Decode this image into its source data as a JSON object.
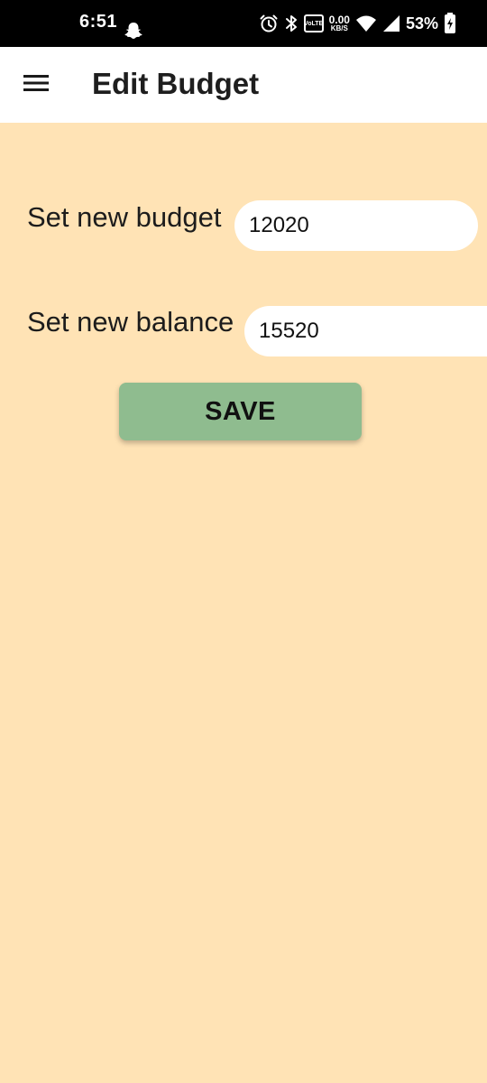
{
  "status_bar": {
    "time": "6:51",
    "icons": [
      "snapchat-icon",
      "alarm-icon",
      "bluetooth-icon",
      "volte-icon",
      "wifi-icon",
      "signal-icon",
      "battery-charging-icon"
    ],
    "volte_text_top": "Vo",
    "volte_text_bottom": "LTE",
    "net_speed": "0.00",
    "net_speed_unit": "KB/S",
    "battery_percent": "53%"
  },
  "app_bar": {
    "title": "Edit Budget",
    "menu_icon": "hamburger-menu-icon"
  },
  "form": {
    "budget_label": "Set new budget",
    "budget_value": "12020",
    "balance_label": "Set new balance",
    "balance_value": "15520",
    "save_label": "SAVE"
  },
  "colors": {
    "background": "#FFE3B5",
    "app_bar": "#FFFFFF",
    "status_bar": "#000000",
    "save_button": "#8FBC8F",
    "input_background": "#FFFFFF"
  }
}
